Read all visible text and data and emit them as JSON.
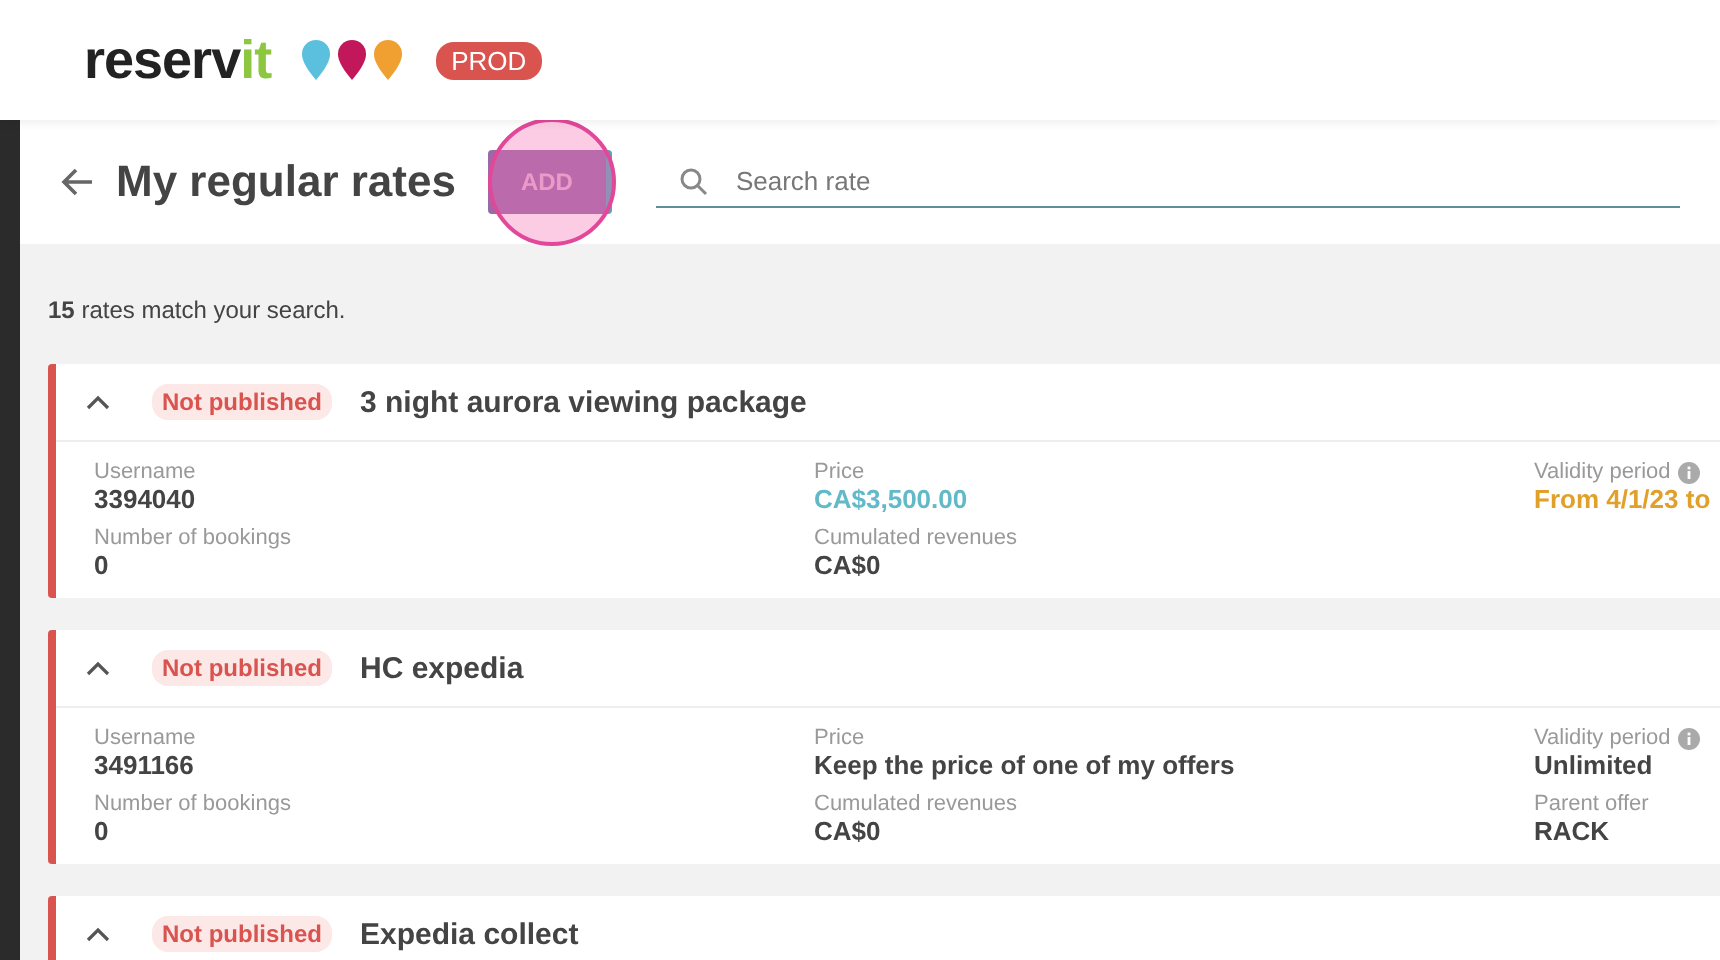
{
  "header": {
    "logo": [
      "reserv",
      "it"
    ],
    "env_badge": "PROD"
  },
  "title_bar": {
    "title": "My regular rates",
    "add_button": "ADD",
    "search": {
      "placeholder": "Search rate"
    }
  },
  "result_count": "**15** rates match your search.",
  "rates": [
    {
      "status": "Not published",
      "published": false,
      "expanded": true,
      "name": "3 night aurora viewing package",
      "columns": [
        [
          {
            "label": "Username",
            "value": "3394040",
            "kind": "plain"
          },
          {
            "label": "Number of bookings",
            "value": "0",
            "kind": "plain"
          }
        ],
        [
          {
            "label": "Price",
            "value": "CA$3,500.00",
            "kind": "price"
          },
          {
            "label": "Cumulated revenues",
            "value": "CA$0",
            "kind": "plain"
          }
        ],
        [
          {
            "label": "Validity period",
            "value": "From 4/1/23 to",
            "kind": "period",
            "info": true
          }
        ]
      ]
    },
    {
      "status": "Not published",
      "published": false,
      "expanded": true,
      "name": "HC expedia",
      "columns": [
        [
          {
            "label": "Username",
            "value": "3491166",
            "kind": "plain"
          },
          {
            "label": "Number of bookings",
            "value": "0",
            "kind": "plain"
          }
        ],
        [
          {
            "label": "Price",
            "value": "Keep the price of one of my offers",
            "kind": "plain"
          },
          {
            "label": "Cumulated revenues",
            "value": "CA$0",
            "kind": "plain"
          }
        ],
        [
          {
            "label": "Validity period",
            "value": "Unlimited",
            "kind": "plain",
            "info": true
          },
          {
            "label": "Parent offer",
            "value": "RACK",
            "kind": "plain"
          }
        ]
      ]
    },
    {
      "status": "Not published",
      "published": false,
      "expanded": true,
      "name": "Expedia collect"
    }
  ]
}
